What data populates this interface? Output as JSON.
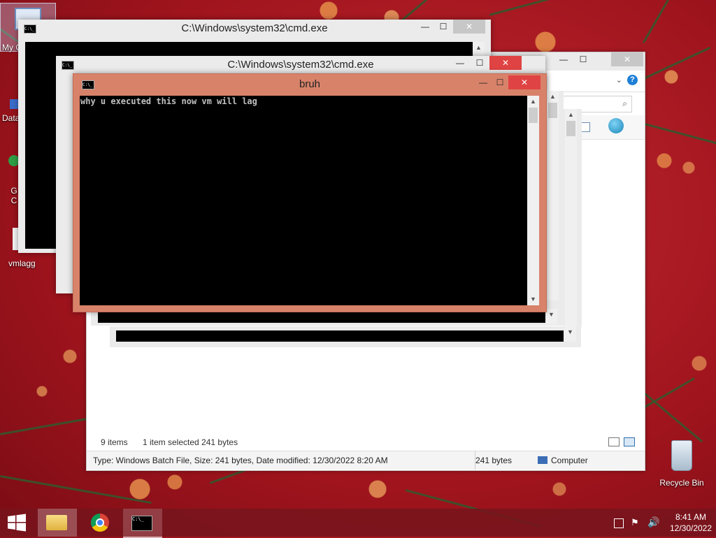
{
  "desktop": {
    "icons": [
      {
        "label": "My C"
      },
      {
        "label": "Data"
      },
      {
        "label": "G"
      },
      {
        "label": "C"
      },
      {
        "label": "vmlagg"
      },
      {
        "label": "Recycle Bin"
      }
    ]
  },
  "explorer": {
    "status_items": "9 items",
    "status_selected": "1 item selected  241 bytes",
    "details_text": "Type: Windows Batch File, Size: 241 bytes, Date modified: 12/30/2022 8:20 AM",
    "details_size": "241 bytes",
    "details_location": "Computer",
    "help_label": "?"
  },
  "cmd_windows": [
    {
      "title": "C:\\Windows\\system32\\cmd.exe"
    },
    {
      "title": "C:\\Windows\\system32\\cmd.exe"
    },
    {
      "title": "bruh",
      "output": "why u executed this now vm will lag"
    }
  ],
  "window_controls": {
    "minimize": "—",
    "maximize": "☐",
    "close": "✕"
  },
  "taskbar": {
    "time": "8:41 AM",
    "date": "12/30/2022",
    "pinned": [
      "file-explorer",
      "chrome",
      "command-prompt"
    ]
  },
  "colors": {
    "active_title": "#d8826a",
    "close_red": "#e04343",
    "console_bg": "#000000",
    "taskbar": "#78141c"
  }
}
